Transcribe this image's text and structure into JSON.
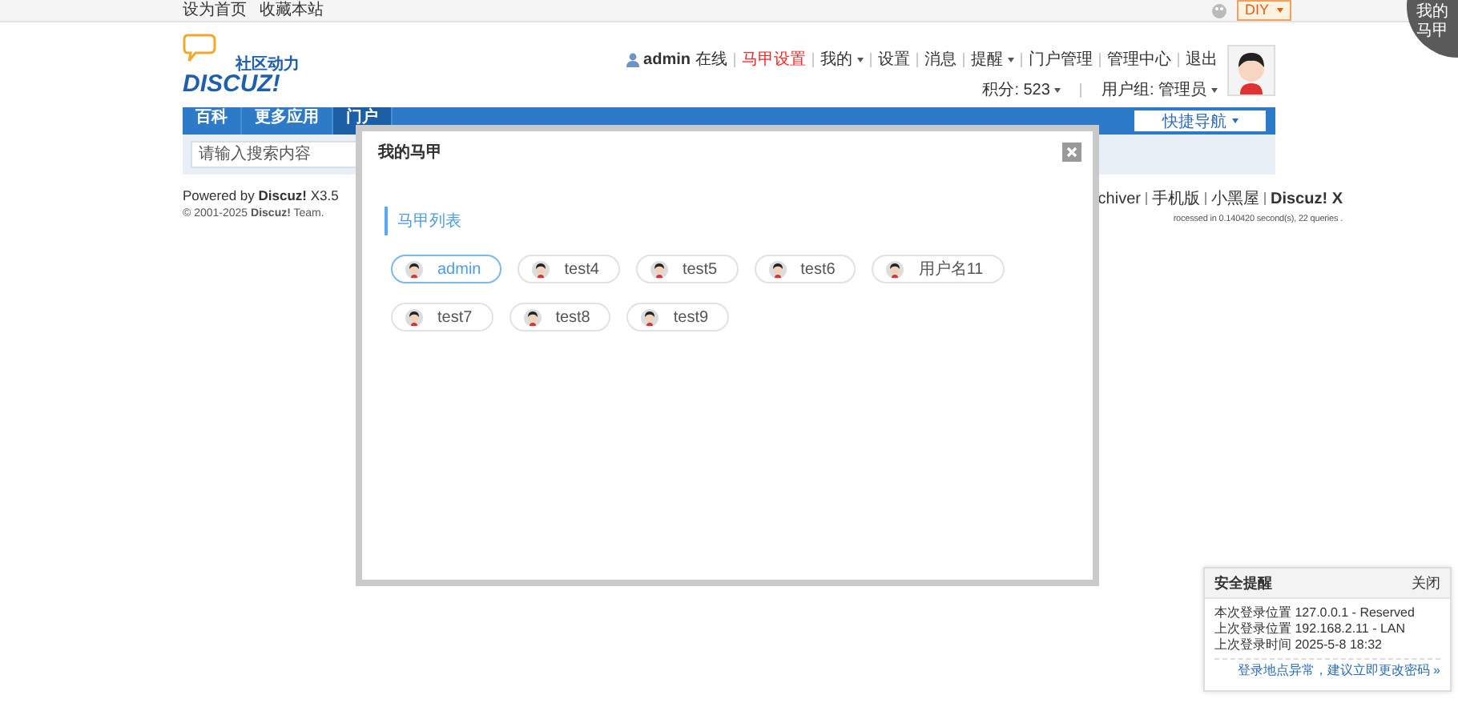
{
  "topbar": {
    "links": [
      "设为首页",
      "收藏本站"
    ],
    "diy": {
      "label": "DIY",
      "dropdown": true
    }
  },
  "corner_badge": {
    "lines": [
      "我的",
      "马甲"
    ]
  },
  "logo": {
    "tagline": "社区动力",
    "name": "DISCUZ!"
  },
  "user": {
    "name": "admin",
    "status": "在线",
    "links": [
      {
        "label": "马甲设置",
        "kind": "highlight",
        "dropdown": false
      },
      {
        "label": "我的",
        "kind": "normal",
        "dropdown": true
      },
      {
        "label": "设置",
        "kind": "normal",
        "dropdown": false
      },
      {
        "label": "消息",
        "kind": "normal",
        "dropdown": false
      },
      {
        "label": "提醒",
        "kind": "normal",
        "dropdown": true
      },
      {
        "label": "门户管理",
        "kind": "normal",
        "dropdown": false
      },
      {
        "label": "管理中心",
        "kind": "normal",
        "dropdown": false
      },
      {
        "label": "退出",
        "kind": "normal",
        "dropdown": false
      }
    ],
    "stats": [
      {
        "label": "积分: 523",
        "dropdown": true
      },
      {
        "label": "用户组: 管理员",
        "dropdown": true
      }
    ]
  },
  "nav": {
    "items": [
      {
        "label": "百科",
        "selected": false
      },
      {
        "label": "更多应用",
        "selected": false
      },
      {
        "label": "门户",
        "selected": true
      }
    ],
    "quick_nav": {
      "label": "快捷导航",
      "dropdown": true
    }
  },
  "search": {
    "placeholder": "请输入搜索内容"
  },
  "footer": {
    "powered": "Powered by **Discuz!** X3.5",
    "copyright": "© 2001-2025 **Discuz!** Team.",
    "links": [
      {
        "label": "chiver",
        "kind": "normal"
      },
      {
        "label": "手机版",
        "kind": "normal"
      },
      {
        "label": "小黑屋",
        "kind": "normal"
      },
      {
        "label": "Discuz! X",
        "kind": "bold"
      }
    ],
    "processed": "rocessed in 0.140420 second(s), 22 queries ."
  },
  "modal": {
    "title": "我的马甲",
    "section": "马甲列表",
    "accounts": [
      {
        "name": "admin",
        "selected": true
      },
      {
        "name": "test4",
        "selected": false
      },
      {
        "name": "test5",
        "selected": false
      },
      {
        "name": "test6",
        "selected": false
      },
      {
        "name": "用户名11",
        "selected": false
      },
      {
        "name": "test7",
        "selected": false
      },
      {
        "name": "test8",
        "selected": false
      },
      {
        "name": "test9",
        "selected": false
      }
    ]
  },
  "security": {
    "title": "安全提醒",
    "close": "关闭",
    "lines": [
      "本次登录位置 127.0.0.1 - Reserved",
      "上次登录位置 192.168.2.11 - LAN",
      "上次登录时间 2025-5-8 18:32"
    ],
    "link": "登录地点异常，建议立即更改密码 »"
  }
}
